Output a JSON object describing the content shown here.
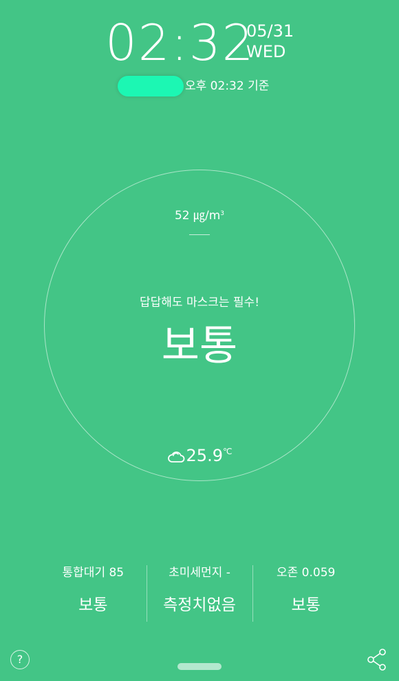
{
  "clock": {
    "time": "02:32",
    "date": "05/31",
    "weekday": "WED"
  },
  "location": {
    "updated": "오후 02:32 기준",
    "pill_color": "#1cf7b3"
  },
  "pm": {
    "value": "52 ㎍/m",
    "unit_sup": "3"
  },
  "tip": "답답해도 마스크는 필수!",
  "status": "보통",
  "weather": {
    "icon": "cloud-icon",
    "temp": "25.9",
    "unit": "℃"
  },
  "stats": [
    {
      "label": "통합대기 85",
      "value": "보통"
    },
    {
      "label": "초미세먼지 -",
      "value": "측정치없음"
    },
    {
      "label": "오존 0.059",
      "value": "보통"
    }
  ],
  "help": {
    "label": "?"
  },
  "colors": {
    "background": "#43c586",
    "text": "#ffffff"
  }
}
